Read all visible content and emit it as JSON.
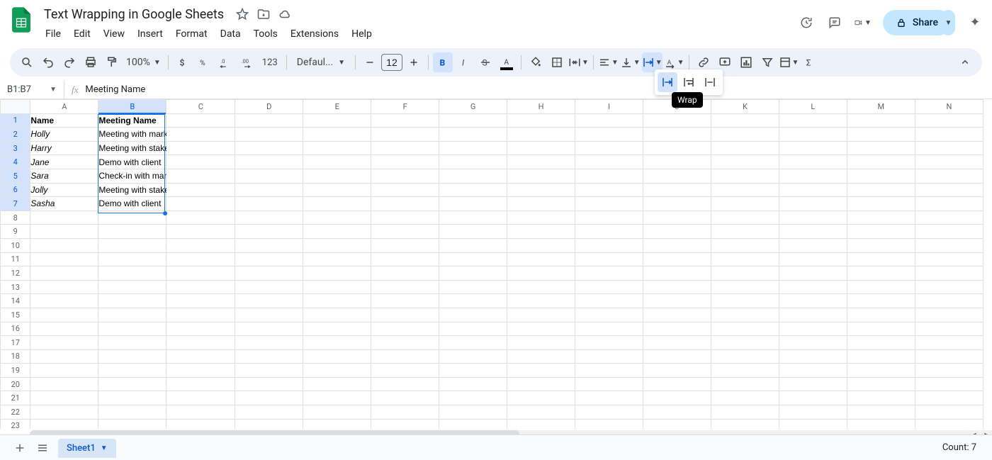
{
  "doc_title": "Text Wrapping in Google Sheets",
  "menus": [
    "File",
    "Edit",
    "View",
    "Insert",
    "Format",
    "Data",
    "Tools",
    "Extensions",
    "Help"
  ],
  "toolbar": {
    "zoom": "100%",
    "font": "Defaul...",
    "font_size": "12",
    "fmt": "123"
  },
  "name_box": "B1:B7",
  "fx_value": "Meeting Name",
  "columns": [
    "A",
    "B",
    "C",
    "D",
    "E",
    "F",
    "G",
    "H",
    "I",
    "J",
    "K",
    "L",
    "M",
    "N"
  ],
  "table": {
    "header": {
      "a": "Name",
      "b": "Meeting Name"
    },
    "rows": [
      {
        "a": "Holly",
        "b": "Meeting with marketing department"
      },
      {
        "a": "Harry",
        "b": "Meeting with stakeholders"
      },
      {
        "a": "Jane",
        "b": "Demo with client"
      },
      {
        "a": "Sara",
        "b": "Check-in with manager"
      },
      {
        "a": "Jolly",
        "b": "Meeting with stakeholders"
      },
      {
        "a": "Sasha",
        "b": "Demo with client"
      }
    ]
  },
  "tooltip": "Wrap",
  "sheet_tab": "Sheet1",
  "count_label": "Count: 7",
  "share": "Share"
}
